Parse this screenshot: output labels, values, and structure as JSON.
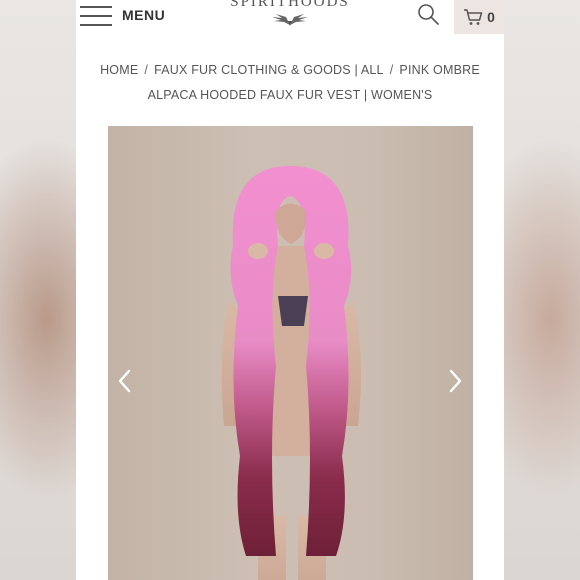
{
  "header": {
    "menu_label": "MENU",
    "logo_text": "SPIRITHOODS",
    "cart_count": "0"
  },
  "breadcrumb": {
    "items": [
      "HOME",
      "FAUX FUR CLOTHING & GOODS | ALL",
      "PINK OMBRE ALPACA HOODED FAUX FUR VEST | WOMEN'S"
    ],
    "separator": "/"
  },
  "icons": {
    "menu": "hamburger-icon",
    "search": "search-icon",
    "cart": "cart-icon",
    "prev": "chevron-left-icon",
    "next": "chevron-right-icon"
  },
  "colors": {
    "fur_pink": "#e88cc6",
    "fur_plum": "#8a2c4c",
    "backdrop": "#c9bbaf"
  }
}
